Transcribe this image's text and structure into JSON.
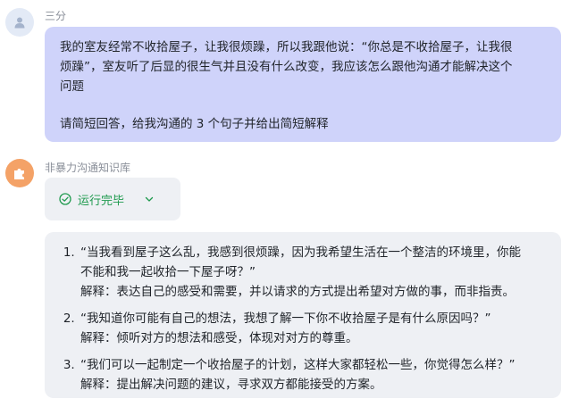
{
  "user": {
    "name": "三分",
    "message_lines": [
      "我的室友经常不收拾屋子，让我很烦躁，所以我跟他说：“你总是不收拾屋子，让我很",
      "烦躁”，室友听了后显的很生气并且没有什么改变，我应该怎么跟他沟通才能解决这个",
      "问题"
    ],
    "instruction": "请简短回答，给我沟通的 3 个句子并给出简短解释"
  },
  "bot": {
    "name": "非暴力沟通知识库",
    "status_label": "运行完毕"
  },
  "answer_items": [
    {
      "quote_lines": [
        "“当我看到屋子这么乱，我感到很烦躁，因为我希望生活在一个整洁的环境里，你能",
        "不能和我一起收拾一下屋子呀？”"
      ],
      "explanation": "解释：表达自己的感受和需要，并以请求的方式提出希望对方做的事，而非指责。"
    },
    {
      "quote_lines": [
        "“我知道你可能有自己的想法，我想了解一下你不收拾屋子是有什么原因吗？”"
      ],
      "explanation": "解释：倾听对方的想法和感受，体现对对方的尊重。"
    },
    {
      "quote_lines": [
        "“我们可以一起制定一个收拾屋子的计划，这样大家都轻松一些，你觉得怎么样？”"
      ],
      "explanation": "解释：提出解决问题的建议，寻求双方都能接受的方案。"
    }
  ],
  "colors": {
    "user_bubble": "#cfd3fa",
    "status_green": "#1f9a4e",
    "answer_bg": "#eef0f4",
    "bot_avatar": "#f4a267"
  },
  "icons": {
    "user_avatar": "person-icon",
    "bot_avatar": "puzzle-icon",
    "status": "check-circle-icon",
    "expand": "chevron-down-icon"
  }
}
